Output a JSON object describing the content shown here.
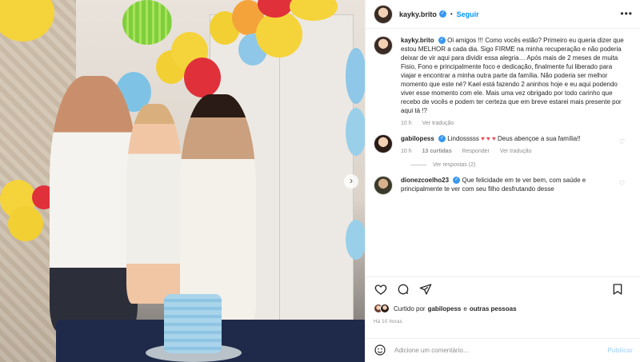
{
  "post": {
    "author": "kayky.brito",
    "follow_label": "Seguir",
    "more_label": "•••",
    "dot": "•"
  },
  "caption": {
    "username": "kayky.brito",
    "text": "Oi amigos !!! Como vocês estão? Primeiro eu queria dizer que estou MELHOR a cada dia. Sigo FIRME na minha recuperação e não poderia deixar de vir aqui para dividir essa alegria… Após mais de 2 meses de muita Fisio, Fono e principalmente foco e dedicação, finalmente fui liberado para viajar e encontrar a minha outra parte da família. Não poderia ser melhor momento que este né? Kael está fazendo 2 aninhos hoje e eu aqui podendo viver esse momento com ele. Mais uma vez obrigado por todo carinho que recebo de vocês e podem ter certeza que em breve estarei mais presente por aqui tá !?",
    "time": "10 h",
    "translate": "Ver tradução"
  },
  "comments": [
    {
      "username": "gabilopess",
      "text_a": "Lindosssss",
      "hearts": "♥ ♥ ♥",
      "text_b": "Deus abençoe a sua família!!",
      "time": "10 h",
      "likes": "13 curtidas",
      "reply": "Responder",
      "translate": "Ver tradução",
      "view_replies": "Ver respostas (2)"
    },
    {
      "username": "dionezcoelho23",
      "text": "Que felicidade em te ver bem, com saúde e principalmente te ver com seu filho desfrutando desse"
    }
  ],
  "likes_line": {
    "prefix": "Curtido por",
    "user": "gabilopess",
    "mid": "e",
    "others": "outras pessoas"
  },
  "time_ago": "Há 10 horas",
  "add_comment": {
    "placeholder": "Adicione um comentário...",
    "post_label": "Publicar"
  },
  "colors": {
    "accent": "#0095f6",
    "like_red": "#ed4956",
    "muted": "#8e8e8e"
  },
  "icons": [
    "more-icon",
    "heart-icon",
    "comment-icon",
    "share-icon",
    "bookmark-icon",
    "emoji-icon",
    "verified-icon",
    "next-photo-icon"
  ]
}
